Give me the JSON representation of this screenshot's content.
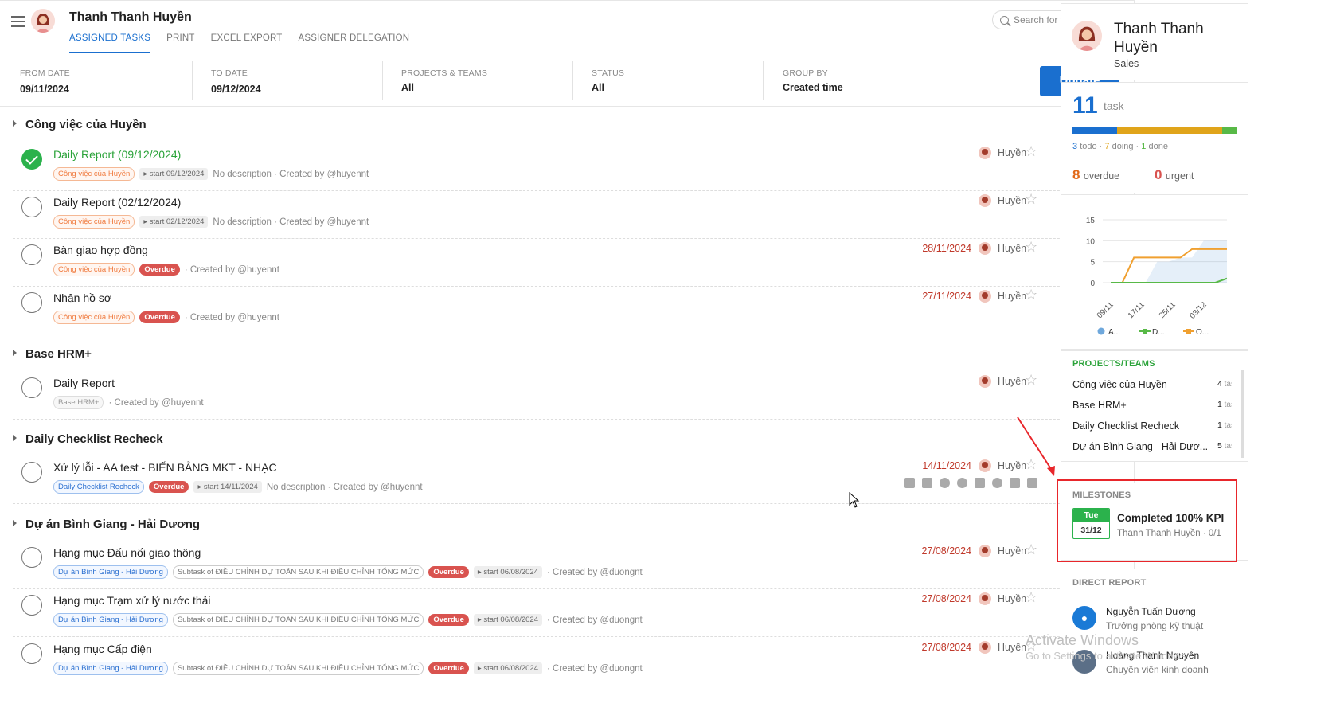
{
  "header": {
    "user_name": "Thanh Thanh Huyền",
    "tabs": [
      "ASSIGNED TASKS",
      "PRINT",
      "EXCEL EXPORT",
      "ASSIGNER DELEGATION"
    ],
    "search_placeholder": "Search for tasks"
  },
  "filters": {
    "from_date": {
      "label": "FROM DATE",
      "value": "09/11/2024"
    },
    "to_date": {
      "label": "TO DATE",
      "value": "09/12/2024"
    },
    "projects": {
      "label": "PROJECTS & TEAMS",
      "value": "All"
    },
    "status": {
      "label": "STATUS",
      "value": "All"
    },
    "group_by": {
      "label": "GROUP BY",
      "value": "Created time"
    },
    "update_label": "Update"
  },
  "groups": [
    {
      "name": "Công việc của Huyền"
    },
    {
      "name": "Base HRM+"
    },
    {
      "name": "Daily Checklist Recheck"
    },
    {
      "name": "Dự án Bình Giang - Hải Dương"
    }
  ],
  "tasks": [
    {
      "name": "Daily Report (09/12/2024)",
      "tag": "Công việc của Huyền",
      "start": "start 09/12/2024",
      "desc": "No description · Created by @huyennt",
      "assignee": "Huyền"
    },
    {
      "name": "Daily Report (02/12/2024)",
      "tag": "Công việc của Huyền",
      "start": "start 02/12/2024",
      "desc": "No description · Created by @huyennt",
      "assignee": "Huyền"
    },
    {
      "name": "Bàn giao hợp đồng",
      "tag": "Công việc của Huyền",
      "overdue": "Overdue",
      "desc": "· Created by @huyennt",
      "due": "28/11/2024",
      "assignee": "Huyền"
    },
    {
      "name": "Nhận hồ sơ",
      "tag": "Công việc của Huyền",
      "overdue": "Overdue",
      "desc": "· Created by @huyennt",
      "due": "27/11/2024",
      "assignee": "Huyền"
    },
    {
      "name": "Daily Report",
      "tag": "Base HRM+",
      "desc": "· Created by @huyennt",
      "assignee": "Huyền"
    },
    {
      "name": "Xử lý lỗi - AA test - BIẾN BẢNG MKT - NHẠC",
      "tag": "Daily Checklist Recheck",
      "overdue": "Overdue",
      "start": "start 14/11/2024",
      "desc": "No description · Created by @huyennt",
      "due": "14/11/2024",
      "assignee": "Huyền"
    },
    {
      "name": "Hạng mục Đấu nối giao thông",
      "tag": "Dự án Bình Giang - Hải Dương",
      "subtask": "Subtask of ĐIỀU CHỈNH DỰ TOÁN SAU KHI ĐIỀU CHỈNH TỔNG MỨC",
      "overdue": "Overdue",
      "start": "start 06/08/2024",
      "desc": "· Created by @duongnt",
      "due": "27/08/2024",
      "assignee": "Huyền"
    },
    {
      "name": "Hạng mục Trạm xử lý nước thải",
      "tag": "Dự án Bình Giang - Hải Dương",
      "subtask": "Subtask of ĐIỀU CHỈNH DỰ TOÁN SAU KHI ĐIỀU CHỈNH TỔNG MỨC",
      "overdue": "Overdue",
      "start": "start 06/08/2024",
      "desc": "· Created by @duongnt",
      "due": "27/08/2024",
      "assignee": "Huyền"
    },
    {
      "name": "Hạng mục Cấp điện",
      "tag": "Dự án Bình Giang - Hải Dương",
      "subtask": "Subtask of ĐIỀU CHỈNH DỰ TOÁN SAU KHI ĐIỀU CHỈNH TỔNG MỨC",
      "overdue": "Overdue",
      "start": "start 06/08/2024",
      "desc": "· Created by @duongnt",
      "due": "27/08/2024",
      "assignee": "Huyền"
    }
  ],
  "sidebar": {
    "profile": {
      "name": "Thanh Thanh Huyền",
      "role": "Sales"
    },
    "stats": {
      "task_count": "11",
      "task_label": "task",
      "todo": "3",
      "todo_label": "todo ·",
      "doing": "7",
      "doing_label": "doing ·",
      "done": "1",
      "done_label": "done",
      "overdue": "8",
      "overdue_label": "overdue",
      "urgent": "0",
      "urgent_label": "urgent",
      "progress": {
        "todo": 3,
        "doing": 7,
        "done": 1
      },
      "colors": {
        "todo": "#1a6fcf",
        "doing": "#e0a41a",
        "done": "#58b947",
        "overdue": "#e26a1a",
        "urgent": "#d9534f"
      }
    },
    "projects_title": "PROJECTS/TEAMS",
    "projects": [
      {
        "name": "Công việc của Huyền",
        "count": "4",
        "unit": "task"
      },
      {
        "name": "Base HRM+",
        "count": "1",
        "unit": "task"
      },
      {
        "name": "Daily Checklist Recheck",
        "count": "1",
        "unit": "task"
      },
      {
        "name": "Dự án Bình Giang - Hải Dươ...",
        "count": "5",
        "unit": "task"
      }
    ],
    "milestones_title": "MILESTONES",
    "milestone": {
      "day": "Tue",
      "date": "31/12",
      "title": "Completed 100% KPI",
      "owner": "Thanh Thanh Huyền",
      "progress": "0/1"
    },
    "direct_report_title": "DIRECT REPORT",
    "reports": [
      {
        "name": "Nguyễn Tuấn Dương",
        "title": "Trưởng phòng kỹ thuật"
      },
      {
        "name": "Hoàng Thanh Nguyên",
        "title": "Chuyên viên kinh doanh"
      }
    ]
  },
  "watermark": {
    "line1": "Activate Windows",
    "line2": "Go to Settings to activate Windows."
  },
  "chart_data": {
    "type": "line",
    "x": [
      "09/11",
      "17/11",
      "25/11",
      "03/12"
    ],
    "ylim": [
      0,
      15
    ],
    "yticks": [
      "15",
      "10",
      "5",
      "0"
    ],
    "legend": [
      "A...",
      "D...",
      "O..."
    ],
    "series": [
      {
        "name": "A...",
        "color": "#6fa8dc",
        "type": "area",
        "values": [
          0,
          0,
          0,
          0,
          5,
          5,
          6,
          6,
          10,
          10,
          10
        ]
      },
      {
        "name": "O...",
        "color": "#f0a030",
        "values": [
          0,
          0,
          6,
          6,
          6,
          6,
          6,
          8,
          8,
          8,
          8
        ]
      },
      {
        "name": "D...",
        "color": "#58b947",
        "values": [
          0,
          0,
          0,
          0,
          0,
          0,
          0,
          0,
          0,
          0,
          1
        ]
      }
    ]
  }
}
